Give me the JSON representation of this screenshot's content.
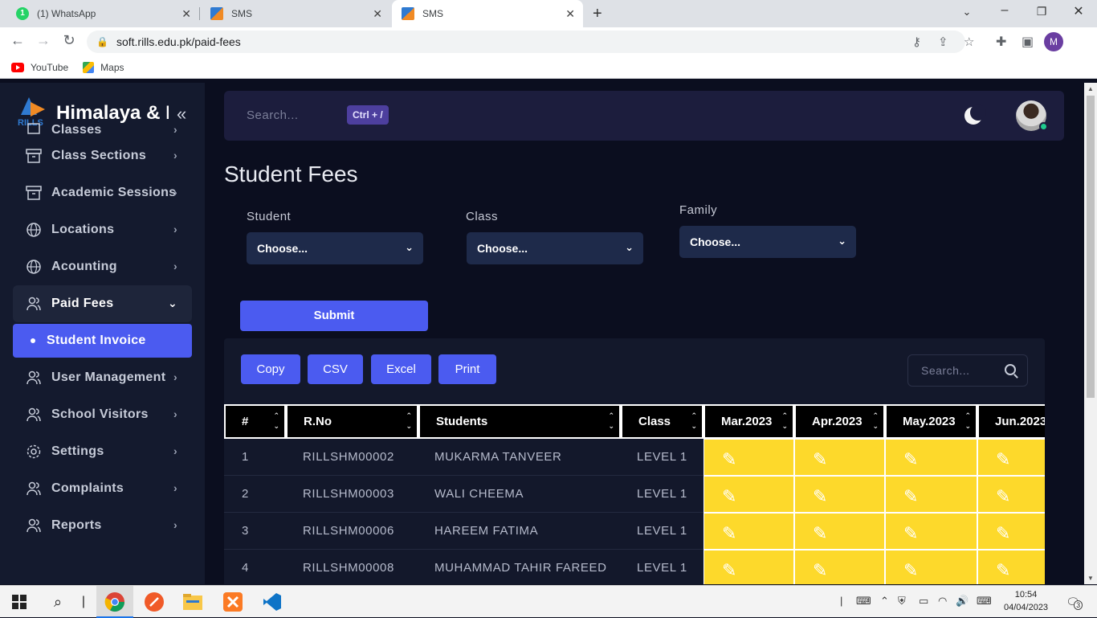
{
  "browser": {
    "tabs": [
      {
        "title": "(1) WhatsApp",
        "favicon": "whatsapp-icon",
        "badge": "1"
      },
      {
        "title": "SMS",
        "favicon": "rills-logo-icon"
      },
      {
        "title": "SMS",
        "favicon": "rills-logo-icon",
        "active": true
      }
    ],
    "url": "soft.rills.edu.pk/paid-fees",
    "bookmarks": [
      "YouTube",
      "Maps"
    ],
    "profile_initial": "M"
  },
  "sidebar": {
    "brand": "Himalaya & I",
    "logo_text": "RILLS",
    "items": [
      {
        "label": "Classes",
        "icon": "classes-icon"
      },
      {
        "label": "Class Sections",
        "icon": "archive-icon"
      },
      {
        "label": "Academic Sessions",
        "icon": "archive-icon"
      },
      {
        "label": "Locations",
        "icon": "globe-icon"
      },
      {
        "label": "Acounting",
        "icon": "globe-icon"
      },
      {
        "label": "Paid Fees",
        "icon": "users-icon",
        "open": true
      },
      {
        "label": "Student Invoice",
        "active": true
      },
      {
        "label": "User Management",
        "icon": "users-icon"
      },
      {
        "label": "School Visitors",
        "icon": "users-icon"
      },
      {
        "label": "Settings",
        "icon": "gear-icon"
      },
      {
        "label": "Complaints",
        "icon": "users-icon"
      },
      {
        "label": "Reports",
        "icon": "users-icon"
      }
    ]
  },
  "topnav": {
    "search_placeholder": "Search...",
    "shortcut": "Ctrl + /"
  },
  "main": {
    "title": "Student Fees",
    "filters": [
      {
        "label": "Student",
        "value": "Choose..."
      },
      {
        "label": "Class",
        "value": "Choose..."
      },
      {
        "label": "Family",
        "value": "Choose..."
      }
    ],
    "submit_label": "Submit"
  },
  "table": {
    "export_buttons": [
      "Copy",
      "CSV",
      "Excel",
      "Print"
    ],
    "search_placeholder": "Search...",
    "columns": [
      "#",
      "R.No",
      "Students",
      "Class",
      "Mar.2023",
      "Apr.2023",
      "May.2023",
      "Jun.2023"
    ],
    "rows": [
      {
        "num": "1",
        "rno": "RILLSHM00002",
        "student": "MUKARMA TANVEER",
        "class": "LEVEL 1"
      },
      {
        "num": "2",
        "rno": "RILLSHM00003",
        "student": "WALI CHEEMA",
        "class": "LEVEL 1"
      },
      {
        "num": "3",
        "rno": "RILLSHM00006",
        "student": "HAREEM FATIMA",
        "class": "LEVEL 1"
      },
      {
        "num": "4",
        "rno": "RILLSHM00008",
        "student": "MUHAMMAD TAHIR FAREED",
        "class": "LEVEL 1"
      }
    ],
    "month_cell_color": "#fdd92b"
  },
  "taskbar": {
    "time": "10:54",
    "date": "04/04/2023",
    "notifications": "3"
  },
  "colors": {
    "accent": "#4b5bf0",
    "sidebar_bg": "#141a2e",
    "page_bg": "#0b0e1f"
  }
}
